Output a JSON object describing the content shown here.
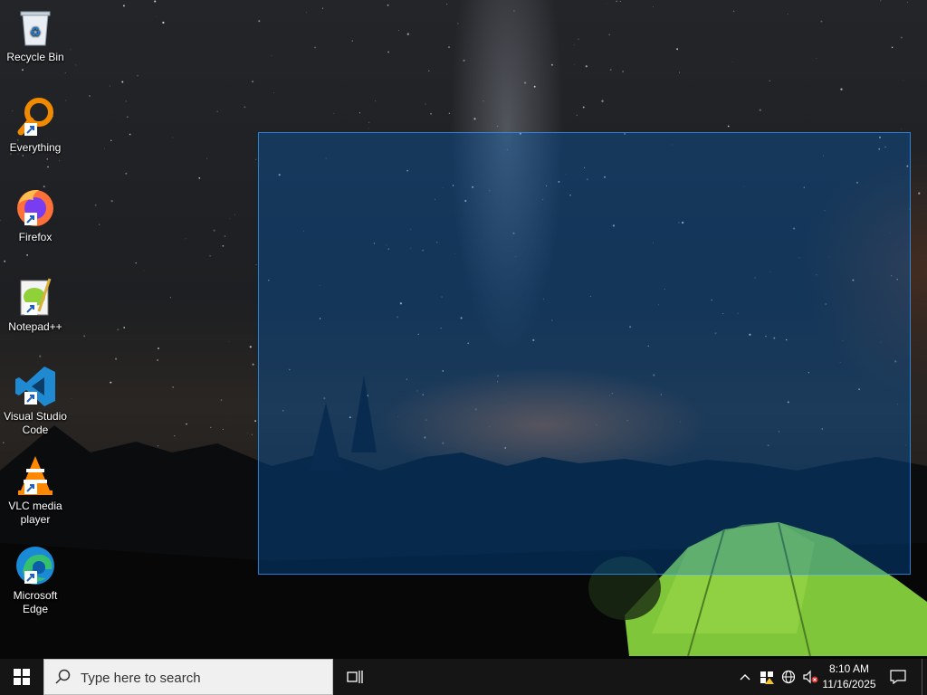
{
  "desktop": {
    "icons": [
      {
        "label": "Recycle Bin",
        "icon": "recycle-bin-icon"
      },
      {
        "label": "Everything",
        "icon": "everything-search-icon"
      },
      {
        "label": "Firefox",
        "icon": "firefox-icon"
      },
      {
        "label": "Notepad++",
        "icon": "notepad-plus-plus-icon"
      },
      {
        "label_line1": "Visual Studio",
        "label_line2": "Code",
        "icon": "vscode-icon"
      },
      {
        "label_line1": "VLC media",
        "label_line2": "player",
        "icon": "vlc-icon"
      },
      {
        "label_line1": "Microsoft",
        "label_line2": "Edge",
        "icon": "edge-icon"
      }
    ]
  },
  "taskbar": {
    "start_icon": "windows-logo-icon",
    "search_placeholder": "Type here to search",
    "taskview_icon": "task-view-icon",
    "tray": {
      "icons": [
        "chevron-up-icon",
        "windows-security-icon",
        "network-globe-icon",
        "volume-muted-icon"
      ]
    },
    "clock": {
      "time": "8:10 AM",
      "date": "11/16/2025"
    },
    "notifications_icon": "action-center-icon"
  }
}
